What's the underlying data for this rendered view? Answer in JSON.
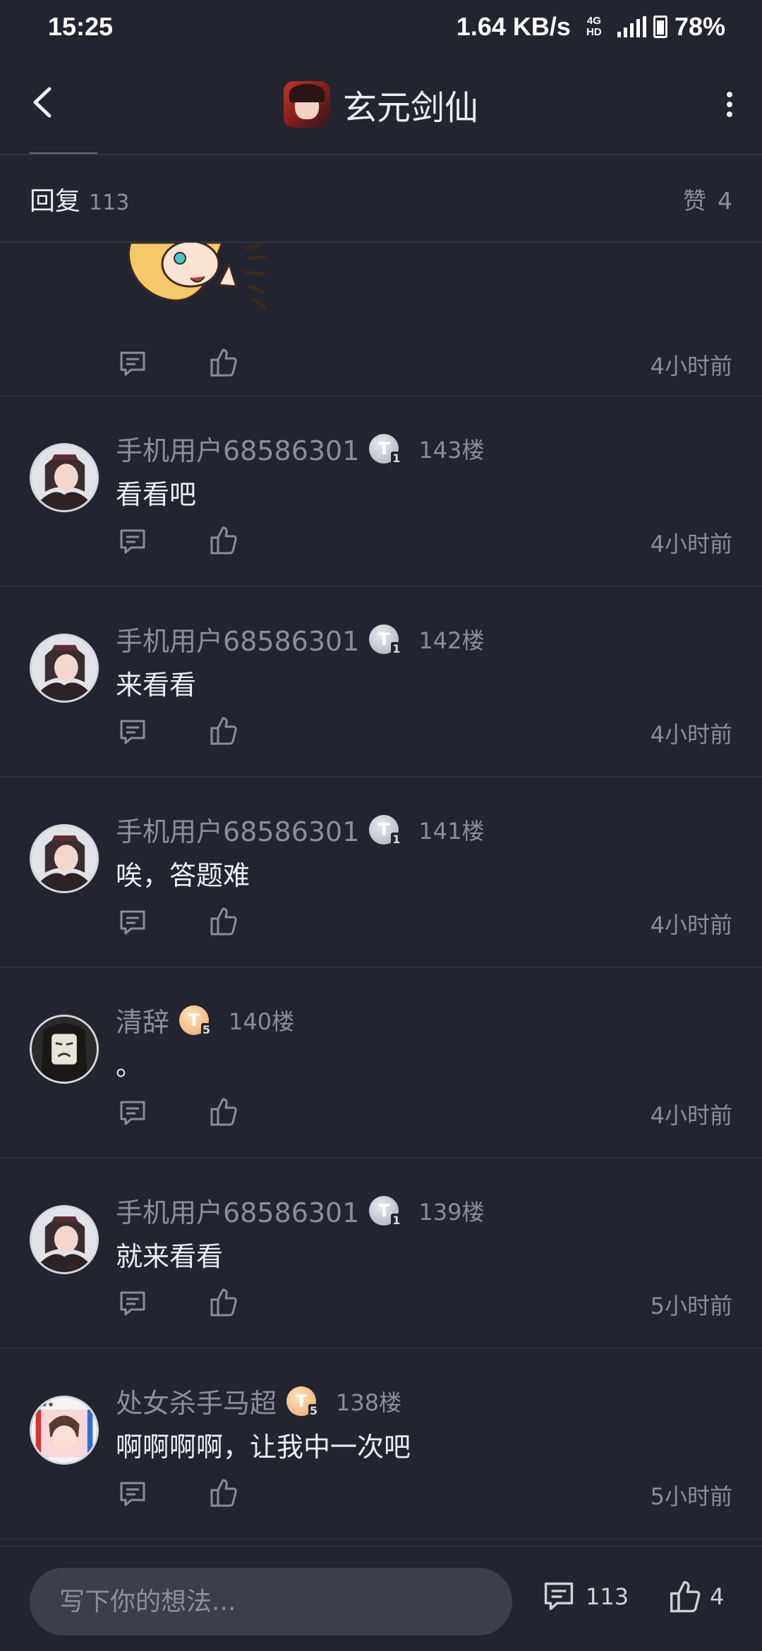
{
  "status_bar": {
    "time": "15:25",
    "network_speed": "1.64 KB/s",
    "network_type": "4G",
    "network_sub": "HD",
    "battery": "78%"
  },
  "header": {
    "title": "玄元剑仙",
    "logo_icon": "game-logo",
    "back_icon": "chevron-left-icon",
    "more_icon": "more-vertical-icon"
  },
  "reply_bar": {
    "label": "回复",
    "count": "113",
    "like_label": "赞",
    "like_count": "4"
  },
  "first_post": {
    "time": "4小时前"
  },
  "comments": [
    {
      "user": "手机用户68586301",
      "level": "T",
      "level_num": "1",
      "badge": "silver",
      "floor": "143楼",
      "text": "看看吧",
      "time": "4小时前"
    },
    {
      "user": "手机用户68586301",
      "level": "T",
      "level_num": "1",
      "badge": "silver",
      "floor": "142楼",
      "text": "来看看",
      "time": "4小时前"
    },
    {
      "user": "手机用户68586301",
      "level": "T",
      "level_num": "1",
      "badge": "silver",
      "floor": "141楼",
      "text": "唉，答题难",
      "time": "4小时前"
    },
    {
      "user": "清辞",
      "level": "T",
      "level_num": "5",
      "badge": "gold",
      "floor": "140楼",
      "text": "。",
      "time": "4小时前"
    },
    {
      "user": "手机用户68586301",
      "level": "T",
      "level_num": "1",
      "badge": "silver",
      "floor": "139楼",
      "text": "就来看看",
      "time": "5小时前"
    },
    {
      "user": "处女杀手马超",
      "level": "T",
      "level_num": "5",
      "badge": "gold",
      "floor": "138楼",
      "text": "啊啊啊啊，让我中一次吧",
      "time": "5小时前"
    }
  ],
  "bottom_bar": {
    "placeholder": "写下你的想法...",
    "comment_count": "113",
    "like_count": "4"
  },
  "colors": {
    "background": "#22242f",
    "text_primary": "#eceef3",
    "text_secondary": "#8b8e98",
    "input_bg": "#3b3e4b"
  }
}
